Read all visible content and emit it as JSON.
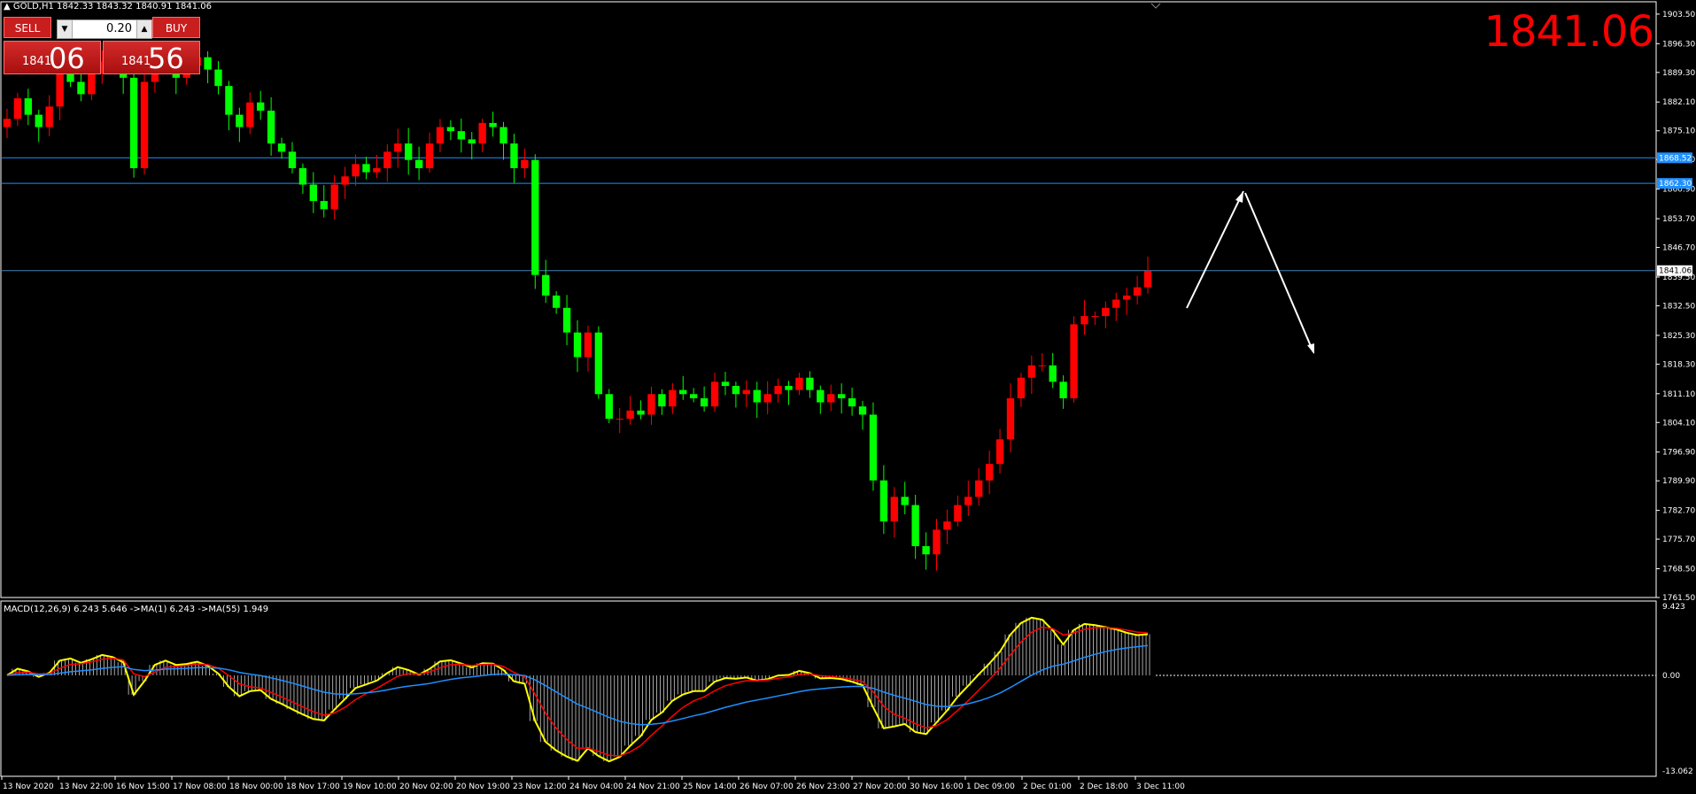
{
  "header": {
    "symbol_text": "GOLD,H1  1842.33 1843.32 1840.91 1841.06"
  },
  "big_price": "1841.06",
  "trade_panel": {
    "sell_label": "SELL",
    "buy_label": "BUY",
    "lot_value": "0.20",
    "sell_small": "1841",
    "sell_large": "06",
    "buy_small": "1841",
    "buy_large": "56"
  },
  "price_axis_labels": [
    "1903.50",
    "1896.30",
    "1889.30",
    "1882.10",
    "1875.10",
    "1868.10",
    "1860.90",
    "1853.70",
    "1846.70",
    "1839.50",
    "1832.50",
    "1825.30",
    "1818.30",
    "1811.10",
    "1804.10",
    "1796.90",
    "1789.90",
    "1782.70",
    "1775.70",
    "1768.50",
    "1761.50"
  ],
  "horizontal_lines": [
    {
      "price": 1868.52,
      "label": "1868.52",
      "color": "#1e90ff"
    },
    {
      "price": 1862.3,
      "label": "1862.30",
      "color": "#1e90ff"
    },
    {
      "price": 1841.06,
      "label": "1841.06",
      "color": "#4682b4"
    }
  ],
  "time_axis_labels": [
    "13 Nov 2020",
    "13 Nov 22:00",
    "16 Nov 15:00",
    "17 Nov 08:00",
    "18 Nov 00:00",
    "18 Nov 17:00",
    "19 Nov 10:00",
    "20 Nov 02:00",
    "20 Nov 19:00",
    "23 Nov 12:00",
    "24 Nov 04:00",
    "24 Nov 21:00",
    "25 Nov 14:00",
    "26 Nov 07:00",
    "26 Nov 23:00",
    "27 Nov 20:00",
    "30 Nov 16:00",
    "1 Dec 09:00",
    "2 Dec 01:00",
    "2 Dec 18:00",
    "3 Dec 11:00"
  ],
  "macd": {
    "label": "MACD(12,26,9) 6.243 5.646  ->MA(1) 6.243  ->MA(55) 1.949",
    "axis_labels": [
      "9.423",
      "0.00",
      "-13.062"
    ],
    "ylim": [
      -13.062,
      9.423
    ]
  },
  "colors": {
    "bull": "#ff0000",
    "bear": "#00ff00",
    "grid": "#ffffff",
    "macd_signal": "#ff0000",
    "macd_line": "#ffff00",
    "ma55": "#1e90ff"
  },
  "chart_data": {
    "type": "candlestick",
    "ylim": [
      1761.5,
      1906.5
    ],
    "close_series": [
      1878,
      1883,
      1879,
      1876,
      1881,
      1889,
      1887,
      1884,
      1889,
      1892,
      1890,
      1888,
      1866,
      1887,
      1894,
      1892,
      1888,
      1891,
      1893,
      1890,
      1886,
      1879,
      1876,
      1882,
      1880,
      1872,
      1870,
      1866,
      1862,
      1858,
      1856,
      1862,
      1864,
      1867,
      1865,
      1866,
      1870,
      1872,
      1868,
      1866,
      1872,
      1876,
      1875,
      1873,
      1872,
      1877,
      1876,
      1872,
      1866,
      1868,
      1840,
      1835,
      1832,
      1826,
      1820,
      1826,
      1811,
      1805,
      1805,
      1807,
      1806,
      1811,
      1808,
      1812,
      1811,
      1810,
      1808,
      1814,
      1813,
      1811,
      1812,
      1809,
      1811,
      1813,
      1812,
      1815,
      1812,
      1809,
      1811,
      1810,
      1808,
      1806,
      1790,
      1780,
      1786,
      1784,
      1774,
      1772,
      1778,
      1780,
      1784,
      1786,
      1790,
      1794,
      1800,
      1810,
      1815,
      1818,
      1818,
      1814,
      1810,
      1828,
      1830,
      1830,
      1832,
      1834,
      1835,
      1837,
      1841
    ]
  }
}
